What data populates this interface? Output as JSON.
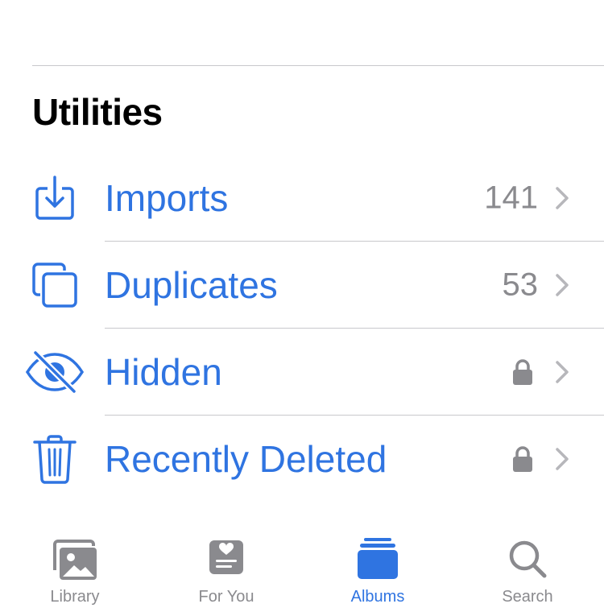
{
  "section": {
    "title": "Utilities"
  },
  "rows": [
    {
      "label": "Imports",
      "count": "141",
      "icon": "import-icon"
    },
    {
      "label": "Duplicates",
      "count": "53",
      "icon": "duplicates-icon"
    },
    {
      "label": "Hidden",
      "count": "",
      "icon": "hidden-eye-icon",
      "locked": true
    },
    {
      "label": "Recently Deleted",
      "count": "",
      "icon": "trash-icon",
      "locked": true
    }
  ],
  "tabs": [
    {
      "label": "Library",
      "icon": "library-icon",
      "active": false
    },
    {
      "label": "For You",
      "icon": "for-you-icon",
      "active": false
    },
    {
      "label": "Albums",
      "icon": "albums-icon",
      "active": true
    },
    {
      "label": "Search",
      "icon": "search-icon",
      "active": false
    }
  ],
  "colors": {
    "accent": "#2f74e1",
    "secondary": "#8a8a8e",
    "separator": "#c8c8cc"
  }
}
